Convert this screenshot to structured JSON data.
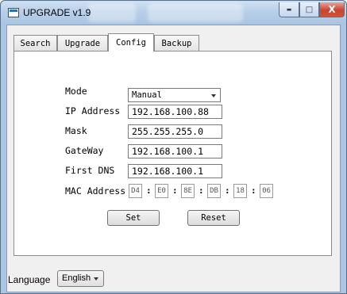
{
  "window": {
    "title": "UPGRADE v1.9",
    "controls": {
      "minimize": "▬",
      "maximize": "□",
      "close": "X"
    }
  },
  "tabs": [
    {
      "label": "Search",
      "active": false
    },
    {
      "label": "Upgrade",
      "active": false
    },
    {
      "label": "Config",
      "active": true
    },
    {
      "label": "Backup",
      "active": false
    }
  ],
  "config": {
    "mode": {
      "label": "Mode",
      "value": "Manual"
    },
    "ip": {
      "label": "IP Address",
      "value": "192.168.100.88"
    },
    "mask": {
      "label": "Mask",
      "value": "255.255.255.0"
    },
    "gateway": {
      "label": "GateWay",
      "value": "192.168.100.1"
    },
    "dns": {
      "label": "First DNS",
      "value": "192.168.100.1"
    },
    "mac": {
      "label": "MAC Address",
      "octets": [
        "D4",
        "E0",
        "8E",
        "DB",
        "18",
        "06"
      ],
      "separator": ":"
    },
    "set_label": "Set",
    "reset_label": "Reset"
  },
  "language": {
    "label": "Language",
    "value": "English"
  },
  "colors": {
    "title_bar": "#b8d0ea",
    "close_button": "#c8442e",
    "panel_bg": "#ffffff",
    "client_bg": "#f0f0f0"
  }
}
